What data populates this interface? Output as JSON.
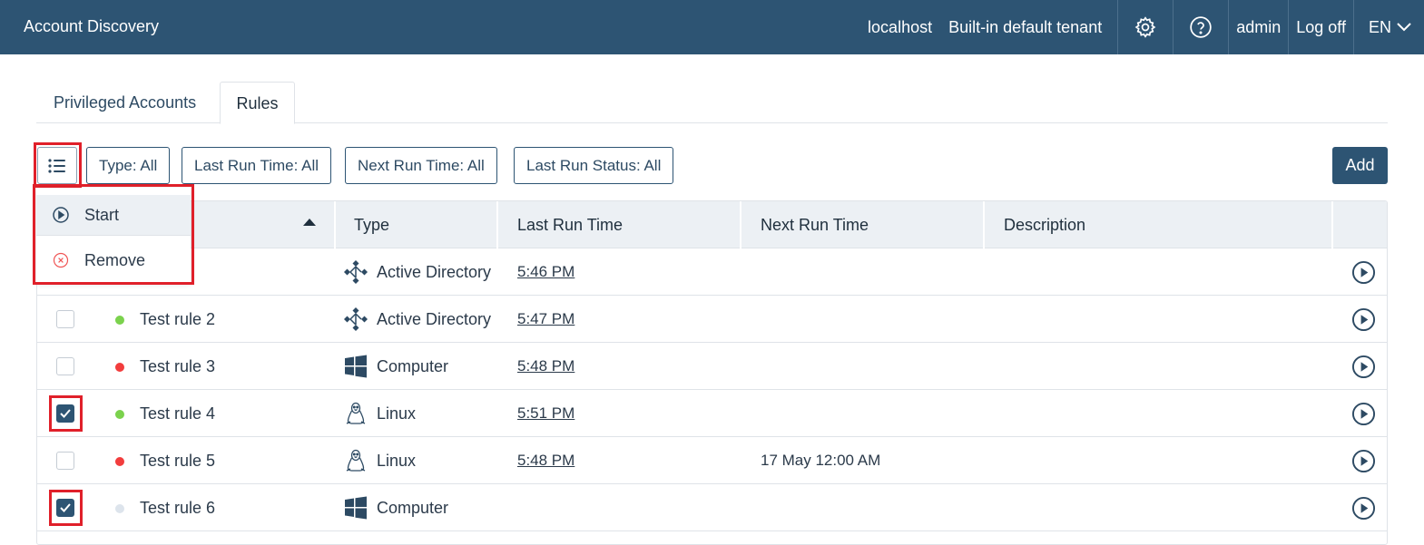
{
  "header": {
    "app_title": "Account Discovery",
    "server": "localhost",
    "tenant": "Built-in default tenant",
    "user": "admin",
    "logoff": "Log off",
    "language": "EN"
  },
  "tabs": [
    {
      "label": "Privileged Accounts",
      "active": false
    },
    {
      "label": "Rules",
      "active": true
    }
  ],
  "filters": {
    "type": "Type: All",
    "last_run_time": "Last Run Time: All",
    "next_run_time": "Next Run Time: All",
    "last_run_status": "Last Run Status: All"
  },
  "add_label": "Add",
  "dropdown": {
    "start": "Start",
    "remove": "Remove"
  },
  "columns": {
    "type": "Type",
    "last_run_time": "Last Run Time",
    "next_run_time": "Next Run Time",
    "description": "Description"
  },
  "colors": {
    "accent": "#2d5473",
    "status_ok": "#7bd24d",
    "status_fail": "#f23d3d",
    "status_none": "#dde4ec",
    "highlight": "#e0202a"
  },
  "rows": [
    {
      "name": "e 1",
      "status": "ok",
      "type": "Active Directory",
      "type_icon": "active-directory-icon",
      "last_run": "5:46 PM",
      "next_run": "",
      "description": "",
      "checked": false
    },
    {
      "name": "Test rule 2",
      "status": "ok",
      "type": "Active Directory",
      "type_icon": "active-directory-icon",
      "last_run": "5:47 PM",
      "next_run": "",
      "description": "",
      "checked": false
    },
    {
      "name": "Test rule 3",
      "status": "fail",
      "type": "Computer",
      "type_icon": "windows-icon",
      "last_run": "5:48 PM",
      "next_run": "",
      "description": "",
      "checked": false
    },
    {
      "name": "Test rule 4",
      "status": "ok",
      "type": "Linux",
      "type_icon": "linux-icon",
      "last_run": "5:51 PM",
      "next_run": "",
      "description": "",
      "checked": true
    },
    {
      "name": "Test rule 5",
      "status": "fail",
      "type": "Linux",
      "type_icon": "linux-icon",
      "last_run": "5:48 PM",
      "next_run": "17 May 12:00 AM",
      "description": "",
      "checked": false
    },
    {
      "name": "Test rule 6",
      "status": "none",
      "type": "Computer",
      "type_icon": "windows-icon",
      "last_run": "",
      "next_run": "",
      "description": "",
      "checked": true
    }
  ]
}
